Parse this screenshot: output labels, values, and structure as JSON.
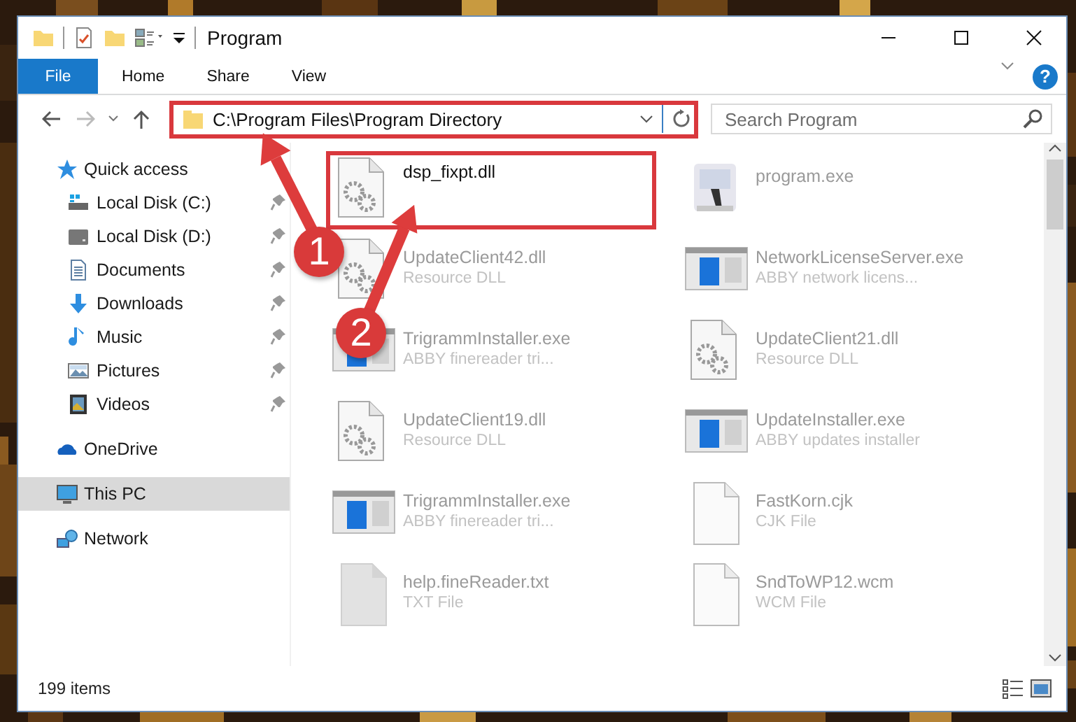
{
  "window": {
    "title": "Program"
  },
  "ribbon_tabs": [
    "File",
    "Home",
    "Share",
    "View"
  ],
  "help_glyph": "?",
  "address": {
    "path": "C:\\Program Files\\Program Directory",
    "highlighted": true
  },
  "search": {
    "placeholder": "Search Program"
  },
  "nav": {
    "items": [
      {
        "label": "Quick access",
        "kind": "star",
        "selected": false,
        "children": [
          {
            "label": "Local Disk (C:)",
            "kind": "drive-win",
            "pinned": true,
            "selected": false
          },
          {
            "label": "Local Disk (D:)",
            "kind": "drive",
            "pinned": true,
            "selected": false
          },
          {
            "label": "Documents",
            "kind": "documents",
            "pinned": true,
            "selected": false
          },
          {
            "label": "Downloads",
            "kind": "downloads",
            "pinned": true,
            "selected": false
          },
          {
            "label": "Music",
            "kind": "music",
            "pinned": true,
            "selected": false
          },
          {
            "label": "Pictures",
            "kind": "pictures",
            "pinned": true,
            "selected": false
          },
          {
            "label": "Videos",
            "kind": "videos",
            "pinned": true,
            "selected": false
          }
        ]
      },
      {
        "label": "OneDrive",
        "kind": "cloud",
        "selected": false
      },
      {
        "label": "This PC",
        "kind": "pc",
        "selected": true
      },
      {
        "label": "Network",
        "kind": "network",
        "selected": false
      }
    ]
  },
  "files": [
    {
      "name": "dsp_fixpt.dll",
      "kind": "dll",
      "highlighted": true
    },
    {
      "name": "program.exe",
      "kind": "program",
      "highlighted": false
    },
    {
      "name": "UpdateClient42.dll",
      "type": "Resource DLL",
      "kind": "dll",
      "highlighted": false
    },
    {
      "name": "NetworkLicenseServer.exe",
      "type": "ABBY network licens...",
      "kind": "app",
      "highlighted": false
    },
    {
      "name": "TrigrammInstaller.exe",
      "type": "ABBY finereader tri...",
      "kind": "app",
      "highlighted": false
    },
    {
      "name": "UpdateClient21.dll",
      "type": "Resource DLL",
      "kind": "dll",
      "highlighted": false
    },
    {
      "name": "UpdateClient19.dll",
      "type": "Resource DLL",
      "kind": "dll",
      "highlighted": false
    },
    {
      "name": "UpdateInstaller.exe",
      "type": "ABBY updates installer",
      "kind": "app",
      "highlighted": false
    },
    {
      "name": "TrigrammInstaller.exe",
      "type": "ABBY finereader tri...",
      "kind": "app",
      "highlighted": false
    },
    {
      "name": "FastKorn.cjk",
      "type": "CJK File",
      "kind": "blank",
      "highlighted": false
    },
    {
      "name": "help.fineReader.txt",
      "type": "TXT File",
      "kind": "text",
      "highlighted": false
    },
    {
      "name": "SndToWP12.wcm",
      "type": "WCM File",
      "kind": "blank",
      "highlighted": false
    }
  ],
  "status_bar": {
    "item_count": "199 items"
  },
  "annotations": [
    {
      "label": "1"
    },
    {
      "label": "2"
    }
  ]
}
